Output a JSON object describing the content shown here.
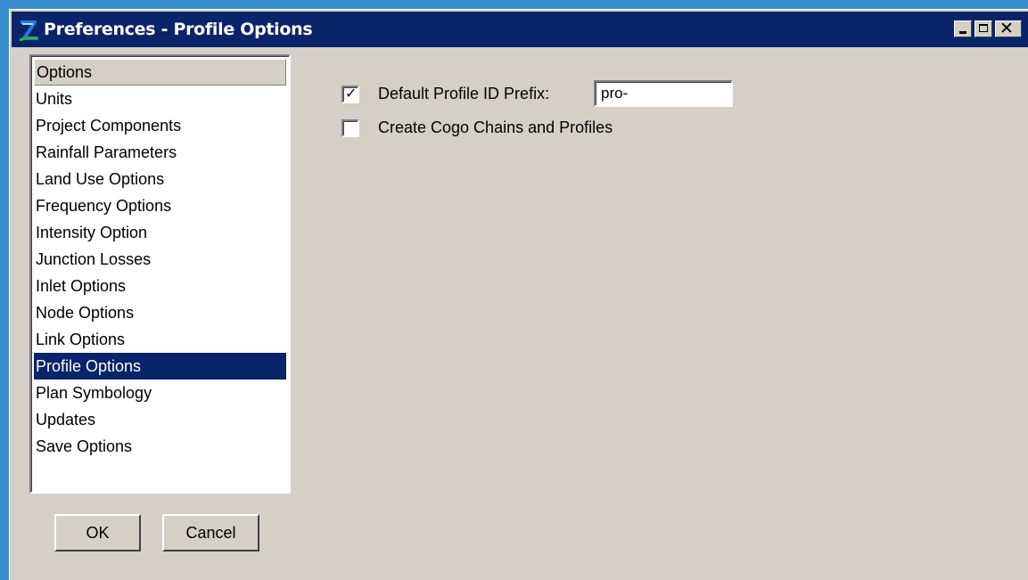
{
  "window": {
    "title": "Preferences - Profile Options",
    "controls": {
      "minimize_icon": "minimize-icon",
      "maximize_icon": "maximize-icon",
      "close_label": "✕"
    }
  },
  "options_list": {
    "header": "Options",
    "items": [
      "Units",
      "Project Components",
      "Rainfall Parameters",
      "Land Use Options",
      "Frequency Options",
      "Intensity Option",
      "Junction Losses",
      "Inlet Options",
      "Node Options",
      "Link Options",
      "Profile Options",
      "Plan Symbology",
      "Updates",
      "Save Options"
    ],
    "selected": "Profile Options"
  },
  "buttons": {
    "ok": "OK",
    "cancel": "Cancel"
  },
  "profile_options": {
    "default_prefix": {
      "label": "Default Profile ID Prefix:",
      "checked": true,
      "value": "pro-"
    },
    "create_cogo": {
      "label": "Create Cogo Chains and Profiles",
      "checked": false
    }
  },
  "colors": {
    "titlebar": "#0a246a",
    "dialog": "#d4d0c8",
    "selection": "#0a246a",
    "desktop": "#3b8fd0"
  }
}
